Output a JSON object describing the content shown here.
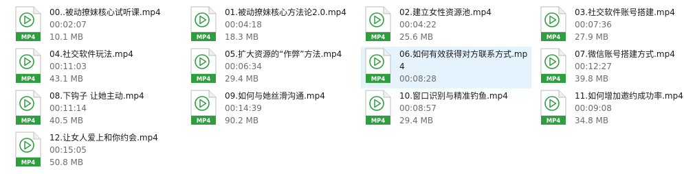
{
  "icon_label": "MP4",
  "colors": {
    "icon_green": "#2e9e3e",
    "selection_bg": "#e5f3ff"
  },
  "files": [
    {
      "name": "00..被动撩妹核心试听课.mp4",
      "duration": "00:02:07",
      "size": "10.1 MB"
    },
    {
      "name": "01.被动撩妹核心方法论2.0.mp4",
      "duration": "00:04:18",
      "size": "18.3 MB"
    },
    {
      "name": "02.建立女性资源池.mp4",
      "duration": "00:04:22",
      "size": "25.6 MB"
    },
    {
      "name": "03.社交软件账号搭建.mp4",
      "duration": "00:07:36",
      "size": "27.9 MB"
    },
    {
      "name": "04.社交软件玩法.mp4",
      "duration": "00:11:03",
      "size": "43.1 MB"
    },
    {
      "name": "05.扩大资源的“作弊”方法.mp4",
      "duration": "00:06:34",
      "size": "29.4 MB"
    },
    {
      "name": "06.如何有效获得对方联系方式.mp4",
      "duration": "00:08:28",
      "size": "",
      "selected": true
    },
    {
      "name": "07.微信账号搭建方式.mp4",
      "duration": "00:12:27",
      "size": "39.8 MB"
    },
    {
      "name": "08.下钩子 让她主动.mp4",
      "duration": "00:11:14",
      "size": "40.5 MB"
    },
    {
      "name": "09.如何与她丝滑沟通.mp4",
      "duration": "00:14:39",
      "size": "90.2 MB"
    },
    {
      "name": "10.窗口识别与精准钓鱼.mp4",
      "duration": "00:08:57",
      "size": "29.4 MB"
    },
    {
      "name": "11.如何增加邀约成功率.mp4",
      "duration": "00:09:08",
      "size": "34.8 MB"
    },
    {
      "name": "12.让女人爱上和你约会.mp4",
      "duration": "00:15:05",
      "size": "50.8 MB"
    }
  ]
}
